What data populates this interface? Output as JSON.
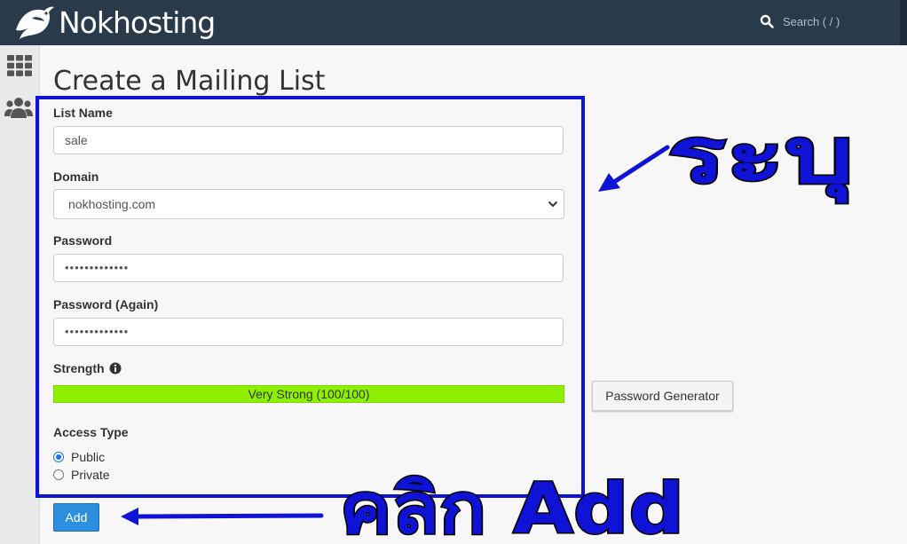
{
  "header": {
    "brand": "Nokhosting",
    "search_placeholder": "Search ( / )"
  },
  "page": {
    "title": "Create a Mailing List"
  },
  "form": {
    "list_name_label": "List Name",
    "list_name_value": "sale",
    "domain_label": "Domain",
    "domain_value": "nokhosting.com",
    "password_label": "Password",
    "password_value": "•••••••••••••",
    "password_again_label": "Password (Again)",
    "password_again_value": "•••••••••••••",
    "strength_label": "Strength",
    "strength_text": "Very Strong (100/100)",
    "strength_percent": 100,
    "generator_label": "Password Generator",
    "access_type_label": "Access Type",
    "access_options": [
      "Public",
      "Private"
    ],
    "access_selected": "Public",
    "add_label": "Add"
  },
  "annotations": {
    "top_right_text": "ระบุ",
    "bottom_text": "คลิก Add",
    "color": "#0f13d6"
  },
  "colors": {
    "topbar": "#293a4a",
    "strength": "#8ef000",
    "primary_button": "#2d8fe0"
  }
}
